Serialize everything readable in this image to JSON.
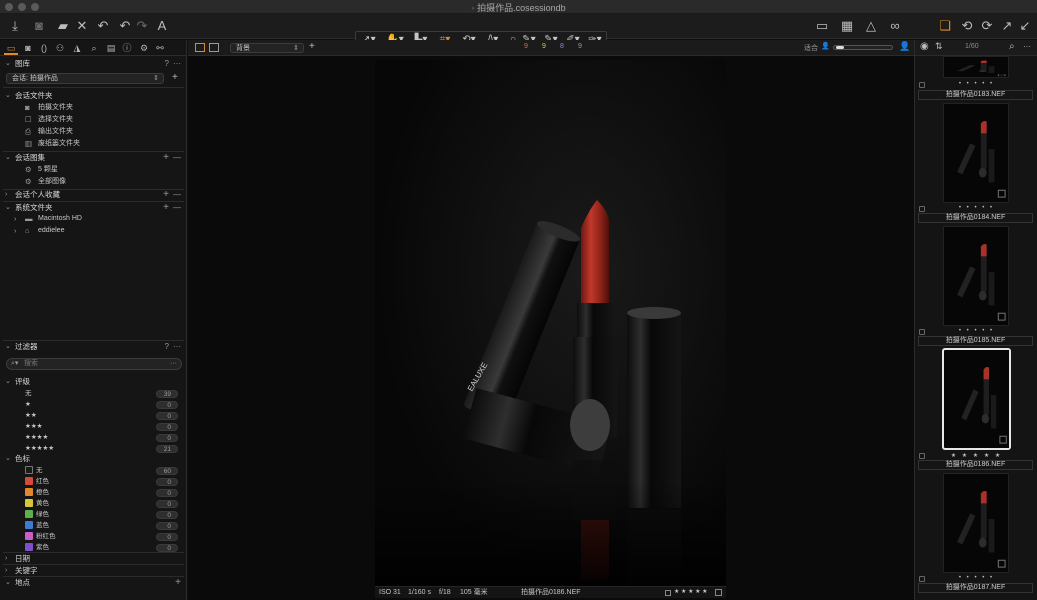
{
  "window": {
    "title": "拍摄作品.cosessiondb"
  },
  "toolbar": {
    "cursor_tools": [
      "select",
      "pan",
      "loupe",
      "crop",
      "rotate",
      "keystone",
      "spot",
      "brush",
      "eraser",
      "gradient",
      "pen"
    ],
    "right_icons": [
      "grid-icon",
      "overlay-icon",
      "warning-icon",
      "glasses-icon"
    ]
  },
  "left_panel": {
    "library": {
      "title": "图库",
      "help": "?",
      "more": "···",
      "session_select": "会话: 拍摄作品",
      "add": "+"
    },
    "session_folders": {
      "title": "会话文件夹",
      "items": [
        "拍摄文件夹",
        "选择文件夹",
        "输出文件夹",
        "废纸篓文件夹"
      ]
    },
    "session_albums": {
      "title": "会话图集",
      "items": [
        "5 颗星",
        "全部图像"
      ],
      "add": "+",
      "remove": "—"
    },
    "session_favorites": {
      "title": "会话个人收藏",
      "add": "+",
      "remove": "—"
    },
    "system_folders": {
      "title": "系统文件夹",
      "items": [
        "Macintosh HD",
        "eddielee"
      ],
      "add": "+",
      "remove": "—"
    },
    "filters": {
      "title": "过滤器",
      "help": "?",
      "more": "···",
      "search_placeholder": "搜索",
      "rating": {
        "title": "评级",
        "rows": [
          {
            "label": "无",
            "count": "39"
          },
          {
            "label": "★",
            "count": "0"
          },
          {
            "label": "★★",
            "count": "0"
          },
          {
            "label": "★★★",
            "count": "0"
          },
          {
            "label": "★★★★",
            "count": "0"
          },
          {
            "label": "★★★★★",
            "count": "21"
          }
        ]
      },
      "color_tag": {
        "title": "色标",
        "rows": [
          {
            "label": "无",
            "count": "60",
            "color": "#1a1a1a"
          },
          {
            "label": "红色",
            "count": "0",
            "color": "#d64a3a"
          },
          {
            "label": "橙色",
            "count": "0",
            "color": "#e0882e"
          },
          {
            "label": "黄色",
            "count": "0",
            "color": "#d6c639"
          },
          {
            "label": "绿色",
            "count": "0",
            "color": "#5bb04a"
          },
          {
            "label": "蓝色",
            "count": "0",
            "color": "#3d7bd0"
          },
          {
            "label": "粉红色",
            "count": "0",
            "color": "#c95fc6"
          },
          {
            "label": "紫色",
            "count": "0",
            "color": "#7d4fc9"
          }
        ]
      },
      "date": {
        "title": "日期"
      },
      "keywords": {
        "title": "关键字"
      },
      "location": {
        "title": "地点",
        "add": "+"
      }
    }
  },
  "viewer_bar": {
    "preset": "背景",
    "add": "+",
    "counters": [
      {
        "value": "9",
        "color": "#e06a55"
      },
      {
        "value": "9",
        "color": "#e0c24a"
      },
      {
        "value": "8",
        "color": "#8a8ae0"
      },
      {
        "value": "9",
        "color": "#9a9a9a"
      }
    ],
    "fit": "适合"
  },
  "photo_brand": "EALUXE",
  "caption": {
    "iso": "ISO 31",
    "shutter": "1/160 s",
    "aperture": "f/18",
    "focal": "105 毫米",
    "filename": "拍摄作品0186.NEF",
    "stars": "★ ★ ★ ★ ★"
  },
  "browser": {
    "counter": "1/60",
    "thumbnails": [
      {
        "name": "拍摄作品0183.NEF",
        "stars": "• • • • •",
        "selected": false
      },
      {
        "name": "拍摄作品0184.NEF",
        "stars": "• • • • •",
        "selected": false
      },
      {
        "name": "拍摄作品0185.NEF",
        "stars": "• • • • •",
        "selected": false
      },
      {
        "name": "拍摄作品0186.NEF",
        "stars": "★ ★ ★ ★ ★",
        "selected": true
      },
      {
        "name": "拍摄作品0187.NEF",
        "stars": "• • • • •",
        "selected": false
      }
    ]
  }
}
